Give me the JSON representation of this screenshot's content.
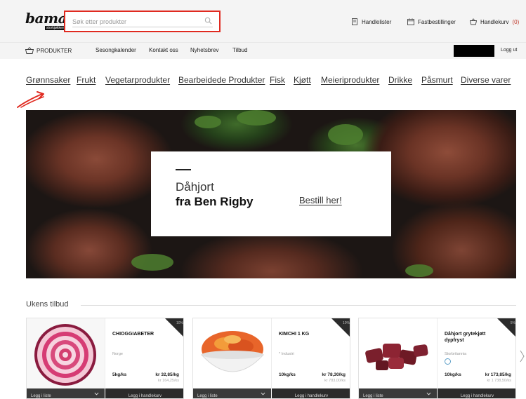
{
  "header": {
    "logo_text": "bama",
    "logo_sub": "storkjøkken",
    "search_placeholder": "Søk etter produkter",
    "links": [
      {
        "label": "Handlelister",
        "icon": "list-icon"
      },
      {
        "label": "Fastbestillinger",
        "icon": "calendar-icon"
      },
      {
        "label": "Handlekurv",
        "icon": "basket-icon",
        "count": "(0)"
      }
    ]
  },
  "nav": {
    "items": [
      "PRODUKTER",
      "Sesongkalender",
      "Kontakt oss",
      "Nyhetsbrev",
      "Tilbud"
    ],
    "logout": "Logg ut"
  },
  "categories": [
    "Grønnsaker",
    "Frukt",
    "Vegetarprodukter",
    "Bearbeidede Produkter",
    "Fisk",
    "Kjøtt",
    "Meieriprodukter",
    "Drikke",
    "Påsmurt",
    "Diverse varer"
  ],
  "banner": {
    "title": "Dåhjort",
    "subtitle": "fra Ben Rigby",
    "cta": "Bestill her!"
  },
  "offers": {
    "title": "Ukens tilbud",
    "products": [
      {
        "name": "CHIOGGIABETER",
        "origin": "Norge",
        "unit": "5kg/ks",
        "price": "kr 32,85/kg",
        "price_total": "kr 164,25/ks",
        "discount": "10%",
        "list_label": "Legg i liste",
        "cart_label": "Legg i handlekurv"
      },
      {
        "name": "KIMCHI 1 KG",
        "origin": "* Industri",
        "unit": "10kg/ks",
        "price": "kr 78,30/kg",
        "price_total": "kr 783,00/ks",
        "discount": "10%",
        "list_label": "Legg i liste",
        "cart_label": "Legg i handlekurv"
      },
      {
        "name": "Dåhjort grytekjøtt dypfryst",
        "origin": "Storbritannia",
        "unit": "10kg/ks",
        "price": "kr 173,85/kg",
        "price_total": "kr 1 738,50/ks",
        "discount": "5%",
        "list_label": "Legg i liste",
        "cart_label": "Legg i handlekurv"
      }
    ]
  },
  "colors": {
    "accent_red": "#e02a20",
    "header_bg": "#f4f4f4",
    "button_dark": "#2b2b2b"
  }
}
